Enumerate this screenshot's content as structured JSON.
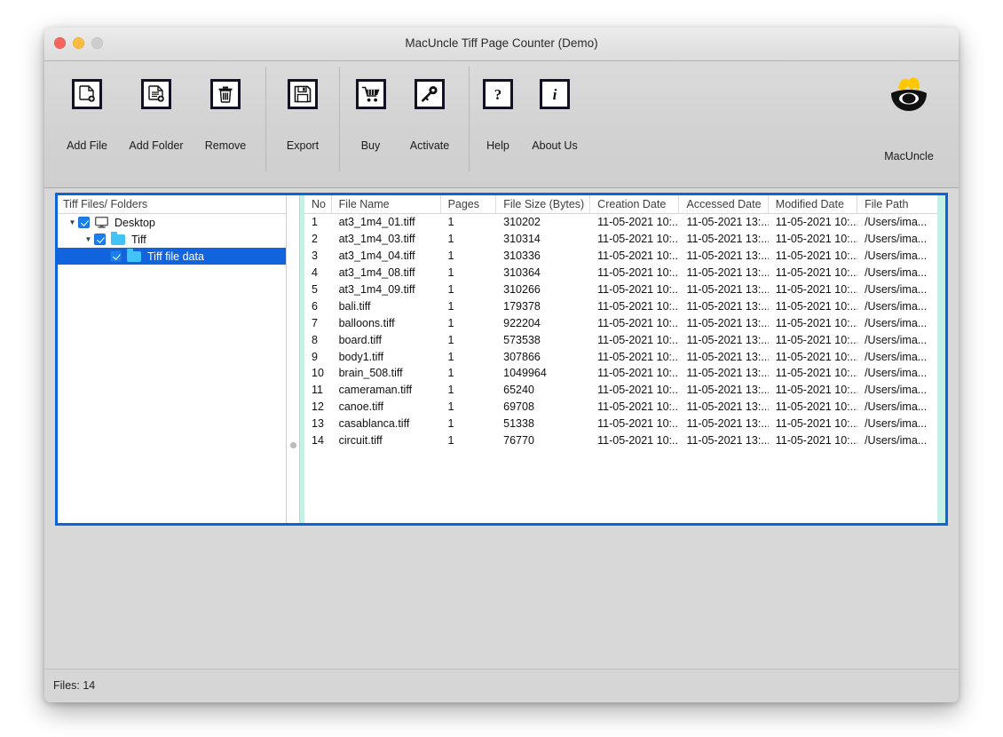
{
  "window": {
    "title": "MacUncle Tiff Page Counter (Demo)",
    "traffic_lights": [
      "close-button",
      "minimize-button",
      "zoom-button"
    ],
    "accent_border": "#0a66d8",
    "scroll_track_color": "#c5f0e6"
  },
  "toolbar": {
    "groups": [
      {
        "items": [
          {
            "label": "Add File",
            "icon": "document-add-icon"
          },
          {
            "label": "Add Folder",
            "icon": "document-lines-add-icon"
          },
          {
            "label": "Remove",
            "icon": "trash-icon"
          }
        ]
      },
      {
        "items": [
          {
            "label": "Export",
            "icon": "floppy-disk-icon"
          }
        ]
      },
      {
        "items": [
          {
            "label": "Buy",
            "icon": "shopping-cart-icon"
          },
          {
            "label": "Activate",
            "icon": "key-icon"
          }
        ]
      },
      {
        "items": [
          {
            "label": "Help",
            "icon": "question-mark-icon"
          },
          {
            "label": "About Us",
            "icon": "info-italic-i-icon"
          }
        ]
      }
    ],
    "brand": {
      "label": "MacUncle",
      "icon": "macuncle-logo-icon"
    }
  },
  "tree": {
    "header": "Tiff Files/ Folders",
    "nodes": [
      {
        "label": "Desktop",
        "icon": "monitor-icon",
        "checked": true,
        "expanded": true,
        "depth": 0,
        "selected": false
      },
      {
        "label": "Tiff",
        "icon": "folder-icon",
        "checked": true,
        "expanded": true,
        "depth": 1,
        "selected": false
      },
      {
        "label": "Tiff file data",
        "icon": "folder-icon",
        "checked": true,
        "expanded": null,
        "depth": 2,
        "selected": true
      }
    ]
  },
  "table": {
    "columns": [
      "No",
      "File Name",
      "Pages",
      "File Size (Bytes)",
      "Creation Date",
      "Accessed Date",
      "Modified Date",
      "File Path"
    ],
    "rows": [
      {
        "no": "1",
        "name": "at3_1m4_01.tiff",
        "pages": "1",
        "size": "310202",
        "created": "11-05-2021 10:...",
        "accessed": "11-05-2021 13:...",
        "modified": "11-05-2021 10:...",
        "path": "/Users/ima..."
      },
      {
        "no": "2",
        "name": "at3_1m4_03.tiff",
        "pages": "1",
        "size": "310314",
        "created": "11-05-2021 10:...",
        "accessed": "11-05-2021 13:...",
        "modified": "11-05-2021 10:...",
        "path": "/Users/ima..."
      },
      {
        "no": "3",
        "name": "at3_1m4_04.tiff",
        "pages": "1",
        "size": "310336",
        "created": "11-05-2021 10:...",
        "accessed": "11-05-2021 13:...",
        "modified": "11-05-2021 10:...",
        "path": "/Users/ima..."
      },
      {
        "no": "4",
        "name": "at3_1m4_08.tiff",
        "pages": "1",
        "size": "310364",
        "created": "11-05-2021 10:...",
        "accessed": "11-05-2021 13:...",
        "modified": "11-05-2021 10:...",
        "path": "/Users/ima..."
      },
      {
        "no": "5",
        "name": "at3_1m4_09.tiff",
        "pages": "1",
        "size": "310266",
        "created": "11-05-2021 10:...",
        "accessed": "11-05-2021 13:...",
        "modified": "11-05-2021 10:...",
        "path": "/Users/ima..."
      },
      {
        "no": "6",
        "name": "bali.tiff",
        "pages": "1",
        "size": "179378",
        "created": "11-05-2021 10:...",
        "accessed": "11-05-2021 13:...",
        "modified": "11-05-2021 10:...",
        "path": "/Users/ima..."
      },
      {
        "no": "7",
        "name": "balloons.tiff",
        "pages": "1",
        "size": "922204",
        "created": "11-05-2021 10:...",
        "accessed": "11-05-2021 13:...",
        "modified": "11-05-2021 10:...",
        "path": "/Users/ima..."
      },
      {
        "no": "8",
        "name": "board.tiff",
        "pages": "1",
        "size": "573538",
        "created": "11-05-2021 10:...",
        "accessed": "11-05-2021 13:...",
        "modified": "11-05-2021 10:...",
        "path": "/Users/ima..."
      },
      {
        "no": "9",
        "name": "body1.tiff",
        "pages": "1",
        "size": "307866",
        "created": "11-05-2021 10:...",
        "accessed": "11-05-2021 13:...",
        "modified": "11-05-2021 10:...",
        "path": "/Users/ima..."
      },
      {
        "no": "10",
        "name": "brain_508.tiff",
        "pages": "1",
        "size": "1049964",
        "created": "11-05-2021 10:...",
        "accessed": "11-05-2021 13:...",
        "modified": "11-05-2021 10:...",
        "path": "/Users/ima..."
      },
      {
        "no": "11",
        "name": "cameraman.tiff",
        "pages": "1",
        "size": "65240",
        "created": "11-05-2021 10:...",
        "accessed": "11-05-2021 13:...",
        "modified": "11-05-2021 10:...",
        "path": "/Users/ima..."
      },
      {
        "no": "12",
        "name": "canoe.tiff",
        "pages": "1",
        "size": "69708",
        "created": "11-05-2021 10:...",
        "accessed": "11-05-2021 13:...",
        "modified": "11-05-2021 10:...",
        "path": "/Users/ima..."
      },
      {
        "no": "13",
        "name": "casablanca.tiff",
        "pages": "1",
        "size": "51338",
        "created": "11-05-2021 10:...",
        "accessed": "11-05-2021 13:...",
        "modified": "11-05-2021 10:...",
        "path": "/Users/ima..."
      },
      {
        "no": "14",
        "name": "circuit.tiff",
        "pages": "1",
        "size": "76770",
        "created": "11-05-2021 10:...",
        "accessed": "11-05-2021 13:...",
        "modified": "11-05-2021 10:...",
        "path": "/Users/ima..."
      }
    ]
  },
  "statusbar": {
    "files_label": "Files: 14"
  }
}
